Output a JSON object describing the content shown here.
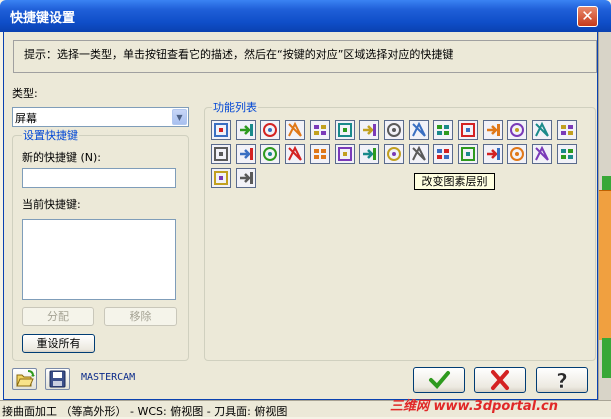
{
  "window": {
    "title": "快捷键设置",
    "close_glyph": "✕"
  },
  "hint": "提示：选择一类型，单击按钮查看它的描述，然后在“按键的对应”区域选择对应的快捷键",
  "type_section": {
    "label": "类型:",
    "selected": "屏幕",
    "dropdown_glyph": "▼"
  },
  "shortcut_group": {
    "title": "设置快捷键",
    "new_key_label": "新的快捷键 (N):",
    "new_key_value": "",
    "current_keys_label": "当前快捷键:",
    "assign_label": "分配",
    "remove_label": "移除",
    "reset_label": "重设所有"
  },
  "function_group": {
    "title": "功能列表",
    "tooltip": "改变图素层别",
    "icons": [
      "hatch-icon",
      "green-arrow-icon",
      "green-plus-icon",
      "red-bracket-icon",
      "orange-gem-icon",
      "red-frame-icon",
      "red-dual-frame-icon",
      "red-bars-icon",
      "red-grid-icon",
      "pink-return-icon",
      "grid-dots-icon",
      "orange-diamond-icon",
      "sigma-icon",
      "dots-grid-icon",
      "book-icon",
      "ellipse-icon",
      "orange-lines-icon",
      "blue-cross-icon",
      "green-cross-icon",
      "green-down-arrow-icon",
      "circle-target-icon",
      "bar-chart-icon",
      "panel-icon",
      "layer-change-icon",
      "palette-icon",
      "green-plus-dots-icon",
      "green-dashes-icon",
      "green-bars-icon",
      "purple-dots-icon",
      "purple-square-icon",
      "blue-square-icon",
      "hourglass-icon"
    ]
  },
  "footer": {
    "open_icon": "open-folder-icon",
    "save_icon": "save-disk-icon",
    "app_text": "MASTERCAM",
    "ok_glyph": "✔",
    "cancel_glyph": "✖",
    "help_glyph": "?"
  },
  "background": {
    "status_text": "接曲面加工 （等高外形） - WCS: 俯视图 - 刀具面: 俯视图",
    "watermark": "三维网 www.3dportal.cn"
  },
  "colors": {
    "title_bar": "#0a41b0",
    "accent_blue": "#0046d5",
    "ok_green": "#2e9a1e",
    "cancel_red": "#d42222"
  }
}
